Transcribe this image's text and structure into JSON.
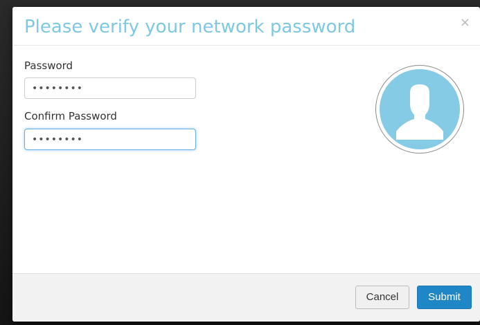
{
  "dialog": {
    "title": "Please verify your network password",
    "close_label": "×"
  },
  "form": {
    "password_label": "Password",
    "password_value": "••••••••",
    "confirm_label": "Confirm Password",
    "confirm_value": "••••••••"
  },
  "avatar": {
    "icon": "user-silhouette-icon",
    "color": "#86cbe5"
  },
  "footer": {
    "cancel_label": "Cancel",
    "submit_label": "Submit"
  },
  "colors": {
    "title": "#7ec8e3",
    "submit": "#1f87c6",
    "focus": "#66afe9"
  }
}
